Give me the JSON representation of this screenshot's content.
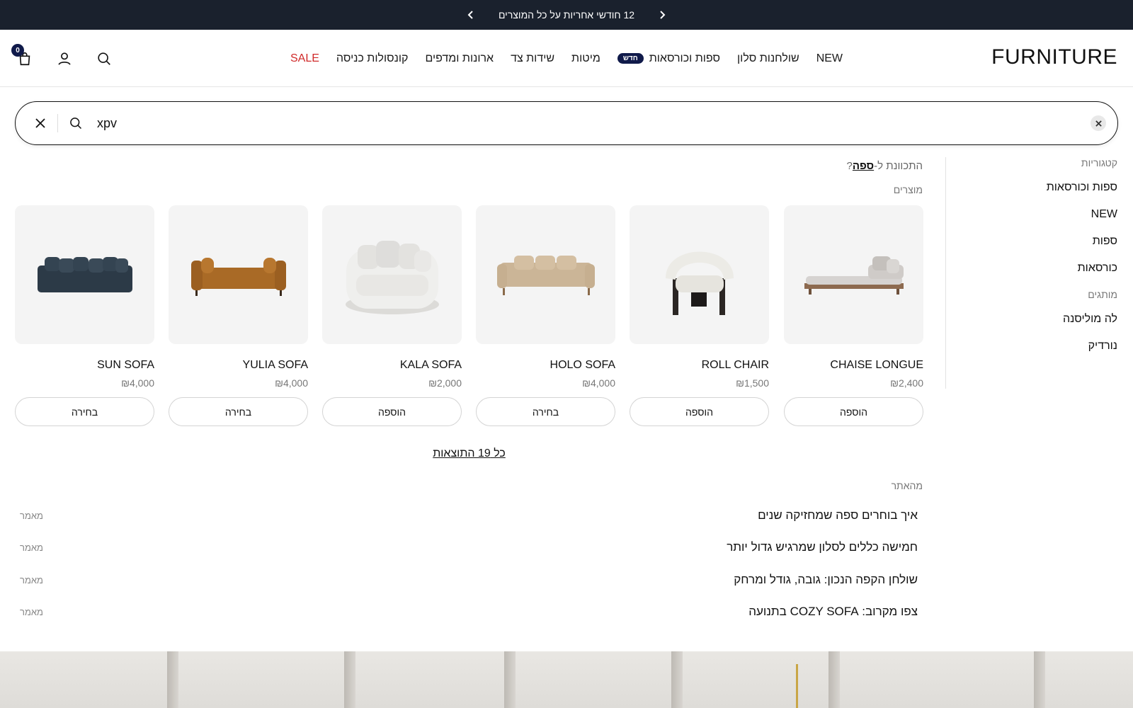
{
  "announcement": {
    "text": "12 חודשי אחריות על כל המוצרים"
  },
  "header": {
    "logo": "FURNITURE",
    "nav": [
      {
        "label": "NEW"
      },
      {
        "label": "שולחנות סלון"
      },
      {
        "label": "ספות וכורסאות",
        "badge": "חדש"
      },
      {
        "label": "מיטות"
      },
      {
        "label": "שידות צד"
      },
      {
        "label": "ארונות ומדפים"
      },
      {
        "label": "קונסולות כניסה"
      },
      {
        "label": "SALE"
      }
    ],
    "cart_count": "0"
  },
  "search": {
    "value": "xpv"
  },
  "suggest": {
    "did_you_mean_prefix": "התכוונת ל-",
    "did_you_mean_term": "ספה",
    "did_you_mean_suffix": "?"
  },
  "sidebar": {
    "categories_title": "קטגוריות",
    "categories": [
      "ספות וכורסאות",
      "NEW",
      "ספות",
      "כורסאות"
    ],
    "brands_title": "מותגים",
    "brands": [
      "לה מוליסנה",
      "נורדיק"
    ]
  },
  "products_title": "מוצרים",
  "products": [
    {
      "name": "CHAISE LONGUE",
      "price": "₪2,400",
      "button": "הוספה"
    },
    {
      "name": "ROLL CHAIR",
      "price": "₪1,500",
      "button": "הוספה"
    },
    {
      "name": "HOLO SOFA",
      "price": "₪4,000",
      "button": "בחירה"
    },
    {
      "name": "KALA SOFA",
      "price": "₪2,000",
      "button": "הוספה"
    },
    {
      "name": "YULIA SOFA",
      "price": "₪4,000",
      "button": "בחירה"
    },
    {
      "name": "SUN SOFA",
      "price": "₪4,000",
      "button": "בחירה"
    }
  ],
  "all_results": "כל 19 התוצאות",
  "blog_title": "מהאתר",
  "articles": [
    {
      "title": "איך בוחרים ספה שמחזיקה שנים",
      "tag": "מאמר"
    },
    {
      "title": "חמישה כללים לסלון שמרגיש גדול יותר",
      "tag": "מאמר"
    },
    {
      "title": "שולחן הקפה הנכון: גובה, גודל ומרחק",
      "tag": "מאמר"
    },
    {
      "title": "צפו מקרוב: COZY SOFA בתנועה",
      "tag": "מאמר"
    }
  ],
  "colors": {
    "announcement_bg": "#1a212d",
    "badge_bg": "#101a4a",
    "sale": "#d02a2a"
  }
}
